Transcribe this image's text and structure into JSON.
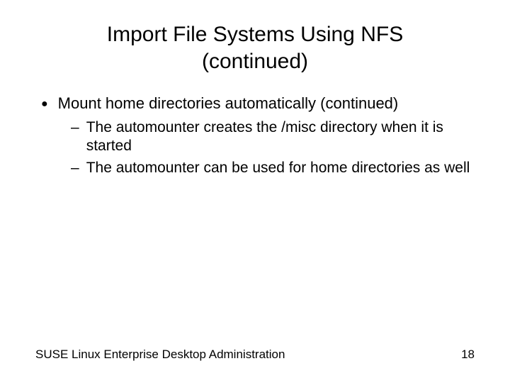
{
  "slide": {
    "title": "Import File Systems Using NFS (continued)",
    "bullet1": "Mount home directories automatically (continued)",
    "sub1": "The automounter creates the /misc directory when it is started",
    "sub2": "The automounter can be used for home directories as well"
  },
  "footer": {
    "left": "SUSE Linux Enterprise Desktop Administration",
    "page": "18"
  }
}
